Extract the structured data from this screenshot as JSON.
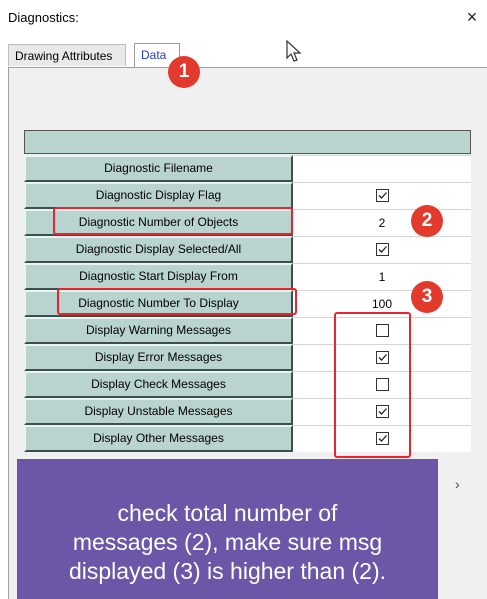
{
  "window": {
    "title": "Diagnostics:",
    "close_glyph": "×"
  },
  "tabs": [
    {
      "label": "Drawing Attributes",
      "active": false
    },
    {
      "label": "Data",
      "active": true
    }
  ],
  "rows": [
    {
      "label": "Diagnostic Filename",
      "type": "text",
      "value": ""
    },
    {
      "label": "Diagnostic Display Flag",
      "type": "checkbox",
      "checked": true
    },
    {
      "label": "Diagnostic Number of Objects",
      "type": "text",
      "value": "2"
    },
    {
      "label": "Diagnostic Display Selected/All",
      "type": "checkbox",
      "checked": true
    },
    {
      "label": "Diagnostic Start Display From",
      "type": "text",
      "value": "1"
    },
    {
      "label": "Diagnostic Number To Display",
      "type": "text",
      "value": "100"
    },
    {
      "label": "Display Warning Messages",
      "type": "checkbox",
      "checked": false
    },
    {
      "label": "Display Error Messages",
      "type": "checkbox",
      "checked": true
    },
    {
      "label": "Display Check Messages",
      "type": "checkbox",
      "checked": false
    },
    {
      "label": "Display Unstable Messages",
      "type": "checkbox",
      "checked": true
    },
    {
      "label": "Display Other Messages",
      "type": "checkbox",
      "checked": true
    }
  ],
  "annotations": {
    "badges": [
      "1",
      "2",
      "3"
    ],
    "note_lines": [
      "check total number of",
      "messages (2), make sure msg",
      "displayed (3) is higher than (2)."
    ],
    "accent_color": "#e8242c",
    "note_color": "#6b56a8"
  },
  "icons": {
    "cursor": "mouse-cursor-icon",
    "chevron": "chevron-right-icon"
  }
}
